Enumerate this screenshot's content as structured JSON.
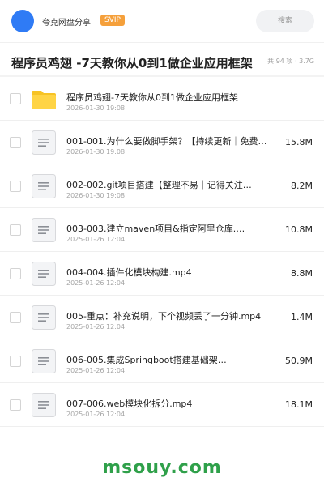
{
  "header": {
    "brand": "夸克网盘分享",
    "badge": "SVIP",
    "search_placeholder": "搜索"
  },
  "folder": {
    "title": "程序员鸡翅 -7天教你从0到1做企业应用框架",
    "summary": "共 94 项 · 3.7G"
  },
  "files": [
    {
      "type": "folder",
      "name": "程序员鸡翅-7天教你从0到1做企业应用框架",
      "date": "2026-01-30 19:08",
      "size": ""
    },
    {
      "type": "file",
      "name": "001-001.为什么要做脚手架？【持续更新｜免费…",
      "date": "2026-01-30 19:08",
      "size": "15.8M"
    },
    {
      "type": "file",
      "name": "002-002.git项目搭建【整理不易｜记得关注…",
      "date": "2026-01-30 19:08",
      "size": "8.2M"
    },
    {
      "type": "file",
      "name": "003-003.建立maven项目&指定阿里仓库.…",
      "date": "2025-01-26 12:04",
      "size": "10.8M"
    },
    {
      "type": "file",
      "name": "004-004.插件化模块构建.mp4",
      "date": "2025-01-26 12:04",
      "size": "8.8M"
    },
    {
      "type": "file",
      "name": "005-重点：补充说明，下个视频丢了一分钟.mp4",
      "date": "2025-01-26 12:04",
      "size": "1.4M"
    },
    {
      "type": "file",
      "name": "006-005.集成Springboot搭建基础架…",
      "date": "2025-01-26 12:04",
      "size": "50.9M"
    },
    {
      "type": "file",
      "name": "007-006.web模块化拆分.mp4",
      "date": "2025-01-26 12:04",
      "size": "18.1M"
    }
  ],
  "watermark": "msouy.com",
  "colors": {
    "accent": "#2f7bf5",
    "badge": "#f5a03b",
    "folder": "#f7c325",
    "watermark": "#2fa04a"
  }
}
